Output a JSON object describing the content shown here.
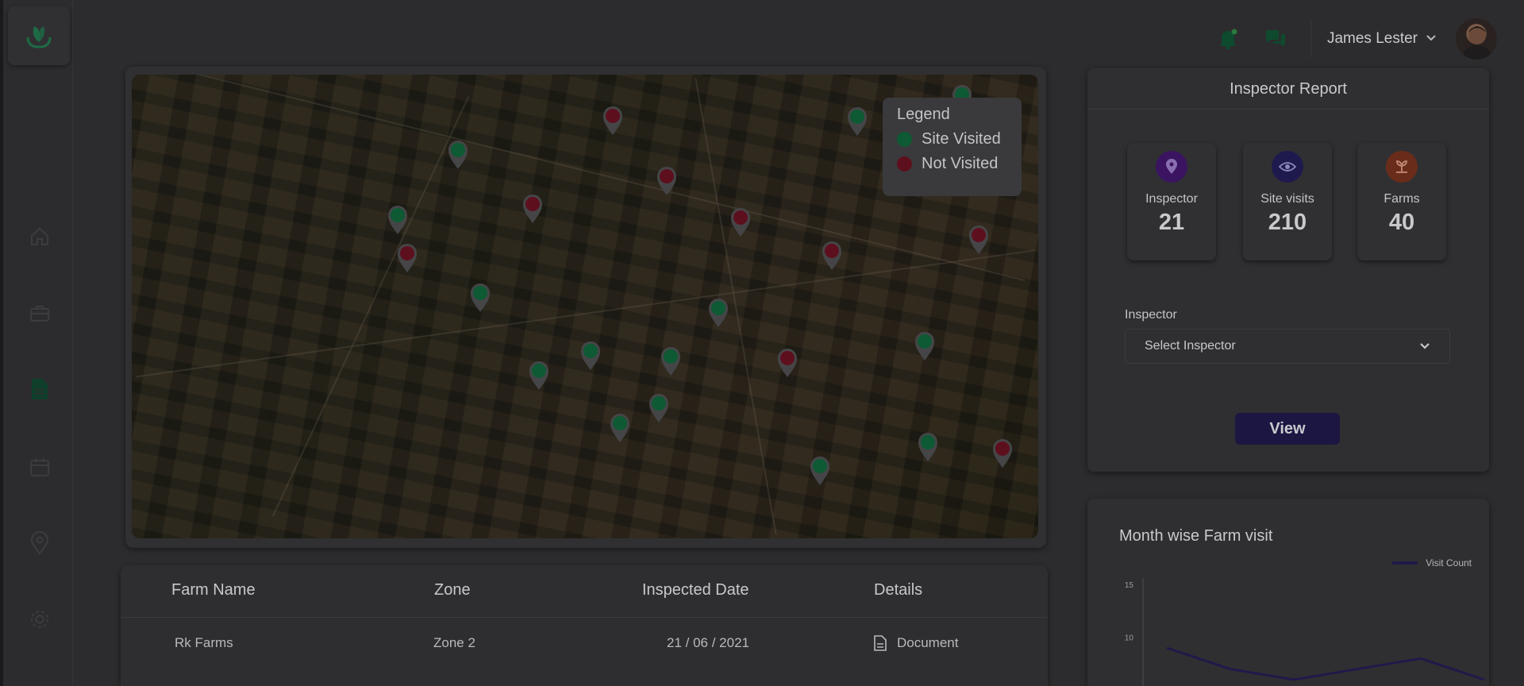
{
  "header": {
    "user_name": "James Lester"
  },
  "legend": {
    "title": "Legend",
    "visited_label": "Site Visited",
    "not_visited_label": "Not Visited",
    "visited_color": "#0e5a34",
    "not_visited_color": "#5e0f1e"
  },
  "table": {
    "headers": [
      "Farm Name",
      "Zone",
      "Inspected Date",
      "Details"
    ],
    "rows": [
      {
        "farm": "Rk Farms",
        "zone": "Zone 2",
        "date": "21 / 06 / 2021",
        "details": "Document"
      }
    ]
  },
  "report": {
    "title": "Inspector Report",
    "stats": [
      {
        "label": "Inspector",
        "value": "21",
        "icon": "pin-icon",
        "color": "#3a1460"
      },
      {
        "label": "Site visits",
        "value": "210",
        "icon": "eye-icon",
        "color": "#1e1a4e"
      },
      {
        "label": "Farms",
        "value": "40",
        "icon": "sprout-icon",
        "color": "#6a2c1a"
      }
    ],
    "inspector_label": "Inspector",
    "select_value": "Select Inspector",
    "view_label": "View"
  },
  "chart": {
    "title": "Month wise Farm visit",
    "legend_label": "Visit Count"
  },
  "chart_data": {
    "type": "line",
    "title": "Month wise Farm visit",
    "series": [
      {
        "name": "Visit Count",
        "values": [
          9,
          7,
          6,
          7,
          8,
          6
        ]
      }
    ],
    "ylim": [
      0,
      15
    ],
    "yticks": [
      "15",
      "10"
    ]
  },
  "map_pins": [
    {
      "status": "visited"
    },
    {
      "status": "not"
    },
    {
      "status": "visited"
    },
    {
      "status": "not"
    },
    {
      "status": "not"
    },
    {
      "status": "visited"
    },
    {
      "status": "not"
    },
    {
      "status": "not"
    },
    {
      "status": "not"
    },
    {
      "status": "not"
    },
    {
      "status": "visited"
    },
    {
      "status": "visited"
    },
    {
      "status": "visited"
    },
    {
      "status": "visited"
    },
    {
      "status": "visited"
    },
    {
      "status": "not"
    },
    {
      "status": "visited"
    },
    {
      "status": "visited"
    },
    {
      "status": "visited"
    },
    {
      "status": "visited"
    },
    {
      "status": "visited"
    },
    {
      "status": "not"
    },
    {
      "status": "visited"
    }
  ]
}
